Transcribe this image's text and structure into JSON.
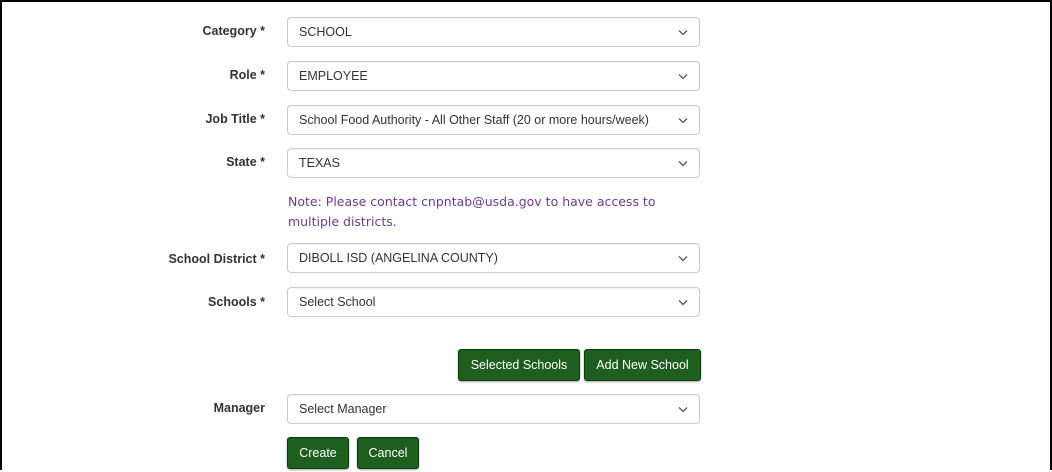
{
  "form": {
    "category": {
      "label": "Category *",
      "value": "SCHOOL"
    },
    "role": {
      "label": "Role *",
      "value": "EMPLOYEE"
    },
    "job_title": {
      "label": "Job Title *",
      "value": "School Food Authority - All Other Staff (20 or more hours/week)"
    },
    "state": {
      "label": "State *",
      "value": "TEXAS"
    },
    "note": "Note: Please contact cnpntab@usda.gov to have access to multiple districts.",
    "school_district": {
      "label": "School District *",
      "value": "DIBOLL ISD (ANGELINA COUNTY)"
    },
    "schools": {
      "label": "Schools *",
      "value": "Select School"
    },
    "manager": {
      "label": "Manager",
      "value": "Select Manager"
    }
  },
  "buttons": {
    "selected_schools": "Selected Schools",
    "add_new_school": "Add New School",
    "create": "Create",
    "cancel": "Cancel"
  },
  "colors": {
    "button_bg": "#1e5e1e",
    "note_text": "#6f3b8c",
    "input_border": "#cccccc"
  },
  "icons": {
    "dropdown": "chevron-down-icon"
  }
}
